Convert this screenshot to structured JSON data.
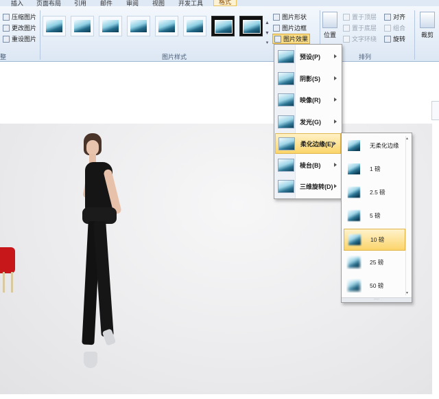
{
  "tabs": [
    "插入",
    "页面布局",
    "引用",
    "邮件",
    "审阅",
    "视图",
    "开发工具",
    "格式"
  ],
  "adjust_group": {
    "buttons": [
      "压缩图片",
      "更改图片",
      "重设图片"
    ],
    "label": "整"
  },
  "styles_group": {
    "label": "图片样式",
    "gallery": [
      {
        "style": "soft"
      },
      {
        "style": "frame"
      },
      {
        "style": "frame"
      },
      {
        "style": "soft"
      },
      {
        "style": "soft"
      },
      {
        "style": "soft"
      },
      {
        "style": "dark"
      },
      {
        "style": "dark"
      }
    ],
    "buttons": [
      "图片形状",
      "图片边框",
      "图片效果"
    ]
  },
  "arrange_group": {
    "label": "排列",
    "position": "位置",
    "buttons": [
      "置于顶层",
      "置于底层",
      "文字环绕",
      "对齐",
      "组合",
      "旋转"
    ]
  },
  "size_group": {
    "crop": "裁剪"
  },
  "effects_menu": {
    "items": [
      {
        "label": "预设(P)",
        "highlighted": false
      },
      {
        "label": "阴影(S)",
        "highlighted": false
      },
      {
        "label": "映像(R)",
        "highlighted": false
      },
      {
        "label": "发光(G)",
        "highlighted": false
      },
      {
        "label": "柔化边缘(E)",
        "highlighted": true
      },
      {
        "label": "棱台(B)",
        "highlighted": false
      },
      {
        "label": "三维旋转(D)",
        "highlighted": false
      }
    ]
  },
  "soft_edges_menu": {
    "items": [
      {
        "label": "无柔化边缘",
        "softness": 0,
        "highlighted": false
      },
      {
        "label": "1 磅",
        "softness": 1,
        "highlighted": false
      },
      {
        "label": "2.5 磅",
        "softness": 2.5,
        "highlighted": false
      },
      {
        "label": "5 磅",
        "softness": 5,
        "highlighted": false
      },
      {
        "label": "10 磅",
        "softness": 10,
        "highlighted": true
      },
      {
        "label": "25 磅",
        "softness": 25,
        "highlighted": false
      },
      {
        "label": "50 磅",
        "softness": 50,
        "highlighted": false
      }
    ]
  },
  "colors": {
    "highlight": "#fbd56a",
    "ribbon": "#dce7f4",
    "chair": "#c7171b"
  }
}
